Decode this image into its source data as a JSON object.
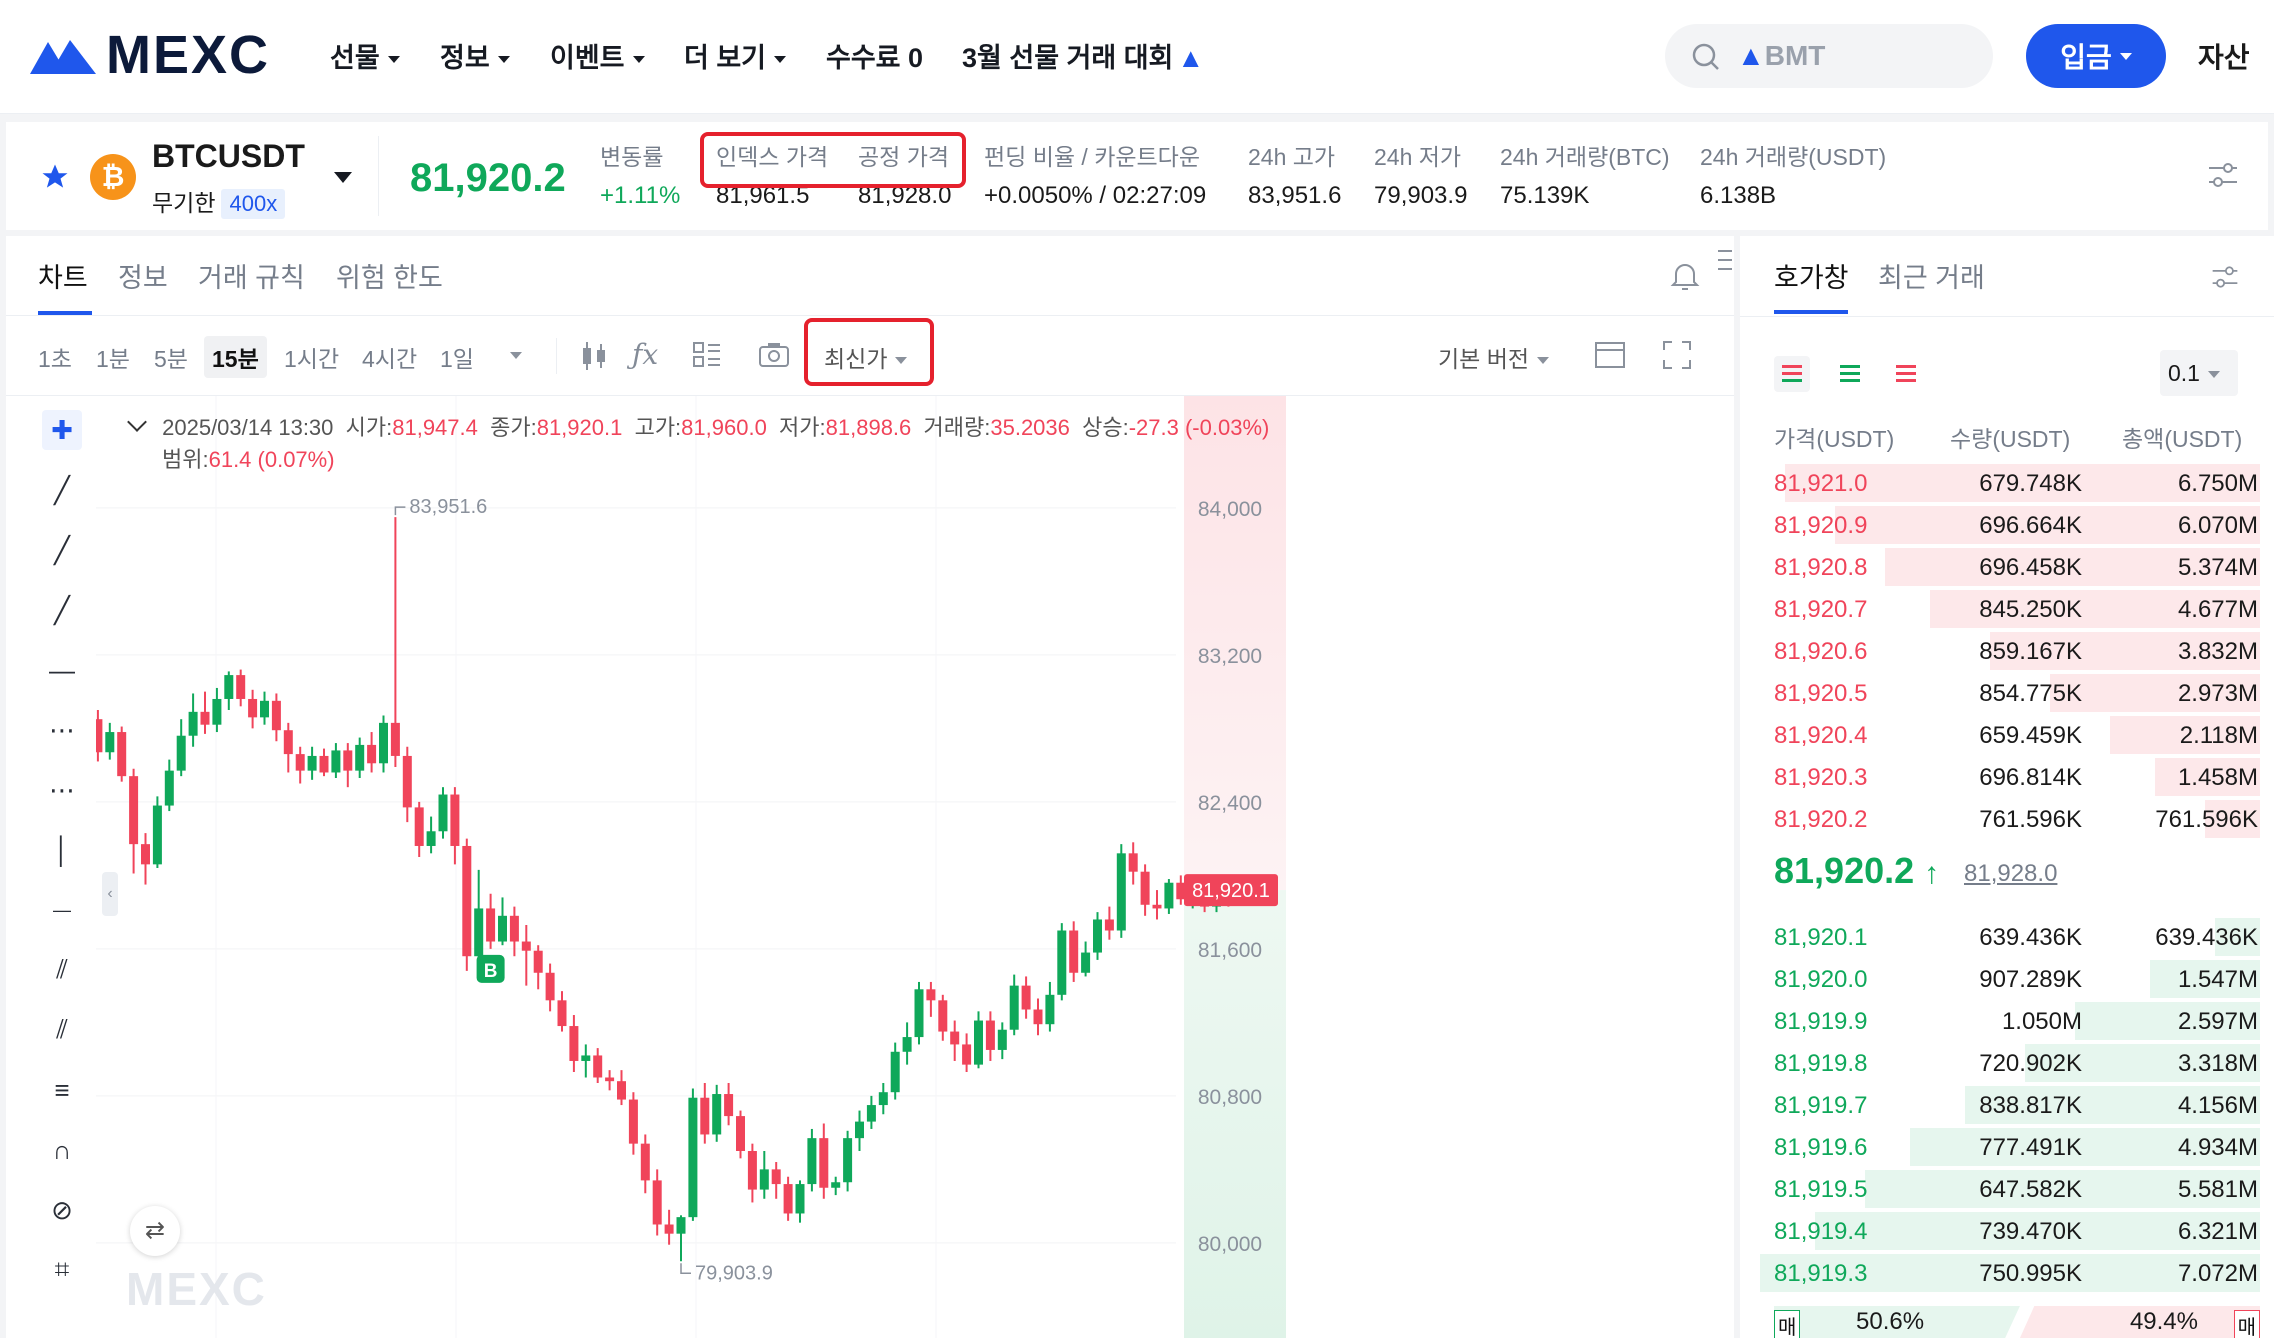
{
  "nav": {
    "logo": "MEXC",
    "items": [
      {
        "label": "선물",
        "caret": true
      },
      {
        "label": "정보",
        "caret": true
      },
      {
        "label": "이벤트",
        "caret": true
      },
      {
        "label": "더 보기",
        "caret": true
      },
      {
        "label": "수수료 0",
        "caret": false
      },
      {
        "label": "3월 선물 거래 대회",
        "caret": false
      }
    ],
    "search_placeholder": "BMT",
    "deposit": "입금",
    "assets": "자산"
  },
  "ticker": {
    "symbol": "BTCUSDT",
    "contract": "무기한",
    "leverage": "400x",
    "last_price": "81,920.2",
    "stats": [
      {
        "label": "변동률",
        "value": "+1.11%"
      },
      {
        "label": "인덱스 가격",
        "value": "81,961.5"
      },
      {
        "label": "공정 가격",
        "value": "81,928.0"
      },
      {
        "label": "펀딩 비율 / 카운트다운",
        "value": "+0.0050% / 02:27:09"
      },
      {
        "label": "24h 고가",
        "value": "83,951.6"
      },
      {
        "label": "24h 저가",
        "value": "79,903.9"
      },
      {
        "label": "24h 거래량(BTC)",
        "value": "75.139K"
      },
      {
        "label": "24h 거래량(USDT)",
        "value": "6.138B"
      }
    ]
  },
  "chart_tabs": [
    "차트",
    "정보",
    "거래 규칙",
    "위험 한도"
  ],
  "timeframes": [
    "1초",
    "1분",
    "5분",
    "15분",
    "1시간",
    "4시간",
    "1일"
  ],
  "active_timeframe": "15분",
  "latest_price_btn": "최신가",
  "base_version": "기본 버전",
  "ohlc": {
    "datetime": "2025/03/14 13:30",
    "open_label": "시가:",
    "open": "81,947.4",
    "close_label": "종가:",
    "close": "81,920.1",
    "high_label": "고가:",
    "high": "81,960.0",
    "low_label": "저가:",
    "low": "81,898.6",
    "vol_label": "거래량:",
    "vol": "35.2036",
    "chg_label": "상승:",
    "chg": "-27.3 (-0.03%)",
    "range_label": "범위:",
    "range": "61.4 (0.07%)"
  },
  "chart_data": {
    "type": "candlestick",
    "y_ticks": [
      84000,
      83200,
      82400,
      81600,
      80800,
      80000
    ],
    "y_tick_labels": [
      "84,000",
      "83,200",
      "82,400",
      "81,600",
      "80,800",
      "80,000"
    ],
    "ylim": [
      79700,
      84500
    ],
    "high_label": "83,951.6",
    "low_label": "79,903.9",
    "current_price_tag": "81,920.1",
    "marker": "B",
    "candles": [
      [
        82920,
        82850,
        82960,
        82760
      ],
      [
        82850,
        82670,
        82900,
        82620
      ],
      [
        82670,
        82780,
        82830,
        82630
      ],
      [
        82780,
        82540,
        82810,
        82510
      ],
      [
        82540,
        82170,
        82580,
        82010
      ],
      [
        82170,
        82060,
        82230,
        81950
      ],
      [
        82060,
        82380,
        82430,
        82040
      ],
      [
        82380,
        82570,
        82630,
        82350
      ],
      [
        82570,
        82760,
        82850,
        82540
      ],
      [
        82760,
        82890,
        82990,
        82700
      ],
      [
        82890,
        82820,
        83000,
        82770
      ],
      [
        82820,
        82960,
        83020,
        82780
      ],
      [
        82960,
        83090,
        83110,
        82900
      ],
      [
        83090,
        82960,
        83120,
        82920
      ],
      [
        82960,
        82860,
        83010,
        82800
      ],
      [
        82860,
        82950,
        83000,
        82820
      ],
      [
        82950,
        82790,
        82990,
        82730
      ],
      [
        82790,
        82660,
        82830,
        82560
      ],
      [
        82660,
        82570,
        82700,
        82500
      ],
      [
        82570,
        82650,
        82700,
        82520
      ],
      [
        82650,
        82560,
        82690,
        82540
      ],
      [
        82560,
        82680,
        82720,
        82530
      ],
      [
        82680,
        82570,
        82720,
        82480
      ],
      [
        82570,
        82710,
        82750,
        82530
      ],
      [
        82710,
        82610,
        82780,
        82560
      ],
      [
        82610,
        82830,
        82870,
        82560
      ],
      [
        82830,
        82650,
        83950,
        82590
      ],
      [
        82650,
        82370,
        82700,
        82290
      ],
      [
        82370,
        82160,
        82400,
        82100
      ],
      [
        82160,
        82240,
        82320,
        82120
      ],
      [
        82240,
        82440,
        82480,
        82200
      ],
      [
        82440,
        82160,
        82480,
        82060
      ],
      [
        82160,
        81560,
        82200,
        81480
      ],
      [
        81560,
        81820,
        82030,
        81540
      ],
      [
        81820,
        81640,
        81900,
        81600
      ],
      [
        81640,
        81780,
        81880,
        81620
      ],
      [
        81780,
        81640,
        81830,
        81560
      ],
      [
        81640,
        81590,
        81730,
        81400
      ],
      [
        81590,
        81470,
        81620,
        81380
      ],
      [
        81470,
        81320,
        81520,
        81260
      ],
      [
        81320,
        81180,
        81370,
        81150
      ],
      [
        81180,
        80990,
        81240,
        80930
      ],
      [
        80990,
        81020,
        81080,
        80900
      ],
      [
        81020,
        80900,
        81060,
        80870
      ],
      [
        80900,
        80880,
        80940,
        80830
      ],
      [
        80880,
        80780,
        80940,
        80750
      ],
      [
        80780,
        80540,
        80820,
        80480
      ],
      [
        80540,
        80340,
        80590,
        80270
      ],
      [
        80340,
        80100,
        80400,
        80040
      ],
      [
        80100,
        80050,
        80180,
        79990
      ],
      [
        80050,
        80140,
        80150,
        79900
      ],
      [
        80140,
        80790,
        80840,
        80120
      ],
      [
        80790,
        80590,
        80870,
        80540
      ],
      [
        80590,
        80810,
        80860,
        80550
      ],
      [
        80810,
        80690,
        80870,
        80640
      ],
      [
        80690,
        80500,
        80720,
        80460
      ],
      [
        80500,
        80290,
        80540,
        80220
      ],
      [
        80290,
        80400,
        80500,
        80240
      ],
      [
        80400,
        80320,
        80440,
        80240
      ],
      [
        80320,
        80160,
        80360,
        80120
      ],
      [
        80160,
        80320,
        80340,
        80110
      ],
      [
        80320,
        80570,
        80620,
        80280
      ],
      [
        80570,
        80300,
        80650,
        80240
      ],
      [
        80300,
        80330,
        80360,
        80260
      ],
      [
        80330,
        80570,
        80610,
        80280
      ],
      [
        80570,
        80660,
        80720,
        80500
      ],
      [
        80660,
        80750,
        80800,
        80620
      ],
      [
        80750,
        80820,
        80870,
        80700
      ],
      [
        80820,
        81040,
        81090,
        80780
      ],
      [
        81040,
        81120,
        81200,
        80970
      ],
      [
        81120,
        81380,
        81420,
        81080
      ],
      [
        81380,
        81320,
        81420,
        81230
      ],
      [
        81320,
        81150,
        81350,
        81100
      ],
      [
        81150,
        81080,
        81210,
        80990
      ],
      [
        81080,
        80970,
        81140,
        80930
      ],
      [
        80970,
        81210,
        81260,
        80950
      ],
      [
        81210,
        81050,
        81260,
        80990
      ],
      [
        81050,
        81160,
        81200,
        81000
      ],
      [
        81160,
        81400,
        81460,
        81130
      ],
      [
        81400,
        81270,
        81450,
        81220
      ],
      [
        81270,
        81190,
        81330,
        81130
      ],
      [
        81190,
        81350,
        81420,
        81150
      ],
      [
        81350,
        81700,
        81740,
        81320
      ],
      [
        81700,
        81470,
        81750,
        81420
      ],
      [
        81470,
        81580,
        81640,
        81450
      ],
      [
        81580,
        81760,
        81800,
        81540
      ],
      [
        81760,
        81700,
        81830,
        81650
      ],
      [
        81700,
        82120,
        82170,
        81660
      ],
      [
        82120,
        82020,
        82180,
        81950
      ],
      [
        82020,
        81840,
        82060,
        81780
      ],
      [
        81840,
        81820,
        81920,
        81760
      ],
      [
        81820,
        81960,
        81980,
        81790
      ],
      [
        81960,
        81870,
        82000,
        81840
      ],
      [
        81870,
        81940,
        81970,
        81820
      ],
      [
        81940,
        81830,
        81980,
        81800
      ],
      [
        81830,
        81910,
        81950,
        81800
      ],
      [
        81910,
        81870,
        81960,
        81830
      ],
      [
        81870,
        81960,
        81990,
        81850
      ],
      [
        81947,
        81920,
        81960,
        81898
      ]
    ]
  },
  "orderbook": {
    "tabs": [
      "호가창",
      "최근 거래"
    ],
    "precision": "0.1",
    "headers": [
      "가격(USDT)",
      "수량(USDT)",
      "총액(USDT)"
    ],
    "asks": [
      {
        "price": "81,921.0",
        "qty": "679.748K",
        "total": "6.750M",
        "depth": 0.95
      },
      {
        "price": "81,920.9",
        "qty": "696.664K",
        "total": "6.070M",
        "depth": 0.85
      },
      {
        "price": "81,920.8",
        "qty": "696.458K",
        "total": "5.374M",
        "depth": 0.75
      },
      {
        "price": "81,920.7",
        "qty": "845.250K",
        "total": "4.677M",
        "depth": 0.66
      },
      {
        "price": "81,920.6",
        "qty": "859.167K",
        "total": "3.832M",
        "depth": 0.54
      },
      {
        "price": "81,920.5",
        "qty": "854.775K",
        "total": "2.973M",
        "depth": 0.42
      },
      {
        "price": "81,920.4",
        "qty": "659.459K",
        "total": "2.118M",
        "depth": 0.3
      },
      {
        "price": "81,920.3",
        "qty": "696.814K",
        "total": "1.458M",
        "depth": 0.21
      },
      {
        "price": "81,920.2",
        "qty": "761.596K",
        "total": "761.596K",
        "depth": 0.11
      }
    ],
    "mid_price": "81,920.2",
    "mid_arrow": "↑",
    "mid_ref": "81,928.0",
    "bids": [
      {
        "price": "81,920.1",
        "qty": "639.436K",
        "total": "639.436K",
        "depth": 0.09
      },
      {
        "price": "81,920.0",
        "qty": "907.289K",
        "total": "1.547M",
        "depth": 0.22
      },
      {
        "price": "81,919.9",
        "qty": "1.050M",
        "total": "2.597M",
        "depth": 0.37
      },
      {
        "price": "81,919.8",
        "qty": "720.902K",
        "total": "3.318M",
        "depth": 0.47
      },
      {
        "price": "81,919.7",
        "qty": "838.817K",
        "total": "4.156M",
        "depth": 0.59
      },
      {
        "price": "81,919.6",
        "qty": "777.491K",
        "total": "4.934M",
        "depth": 0.7
      },
      {
        "price": "81,919.5",
        "qty": "647.582K",
        "total": "5.581M",
        "depth": 0.79
      },
      {
        "price": "81,919.4",
        "qty": "739.470K",
        "total": "6.321M",
        "depth": 0.89
      },
      {
        "price": "81,919.3",
        "qty": "750.995K",
        "total": "7.072M",
        "depth": 1.0
      }
    ],
    "buy_label": "매",
    "sell_label": "매",
    "buy_pct": "50.6%",
    "sell_pct": "49.4%"
  },
  "colors": {
    "up": "#0fa85a",
    "down": "#f0445a",
    "brand": "#1f57ec"
  }
}
